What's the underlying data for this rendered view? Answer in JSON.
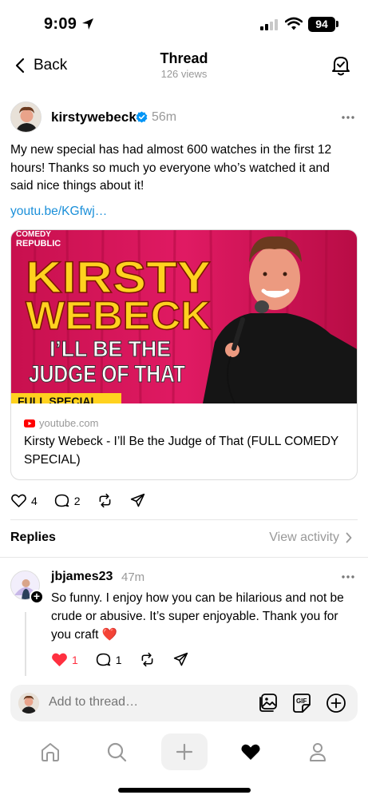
{
  "status_bar": {
    "time": "9:09",
    "battery": "94"
  },
  "nav": {
    "back_label": "Back",
    "title": "Thread",
    "subtitle": "126 views"
  },
  "post": {
    "author": "kirstywebeck",
    "time": "56m",
    "text": "My new special has had almost 600 watches in the first 12 hours! Thanks so much yo everyone who’s watched it and said nice things about it!",
    "link_text": "youtu.be/KGfwj…",
    "card": {
      "site": "youtube.com",
      "title": "Kirsty Webeck - I’ll Be the Judge of That (FULL COMEDY SPECIAL)",
      "thumbnail": {
        "badge_line1": "COMEDY",
        "badge_line2": "REPUBLIC",
        "headline1": "KIRSTY",
        "headline2": "WEBECK",
        "subtitle1": "I’LL BE THE",
        "subtitle2": "JUDGE OF THAT",
        "banner": "FULL SPECIAL"
      }
    },
    "likes": "4",
    "replies": "2"
  },
  "replies_section": {
    "title": "Replies",
    "view_activity": "View activity"
  },
  "reply": {
    "author": "jbjames23",
    "time": "47m",
    "text": "So funny.  I enjoy how you can be hilarious and not be crude or abusive.  It’s super enjoyable.  Thank you for you craft ❤️",
    "likes": "1",
    "replies": "1"
  },
  "composer": {
    "placeholder": "Add to thread…",
    "gif_label": "GIF"
  },
  "colors": {
    "link": "#1a8fd9",
    "like_red": "#ff3040",
    "verified": "#0095f6",
    "thumb_bg": "#d4145a",
    "thumb_yellow": "#ffd21f"
  },
  "icons": [
    "location-arrow-icon",
    "signal-icon",
    "wifi-icon",
    "chevron-left-icon",
    "bell-check-icon",
    "verified-icon",
    "more-icon",
    "youtube-icon",
    "heart-icon",
    "comment-icon",
    "repost-icon",
    "share-icon",
    "chevron-right-icon",
    "image-icon",
    "gif-icon",
    "plus-circle-icon",
    "home-icon",
    "search-icon",
    "plus-icon",
    "heart-filled-icon",
    "person-icon"
  ]
}
